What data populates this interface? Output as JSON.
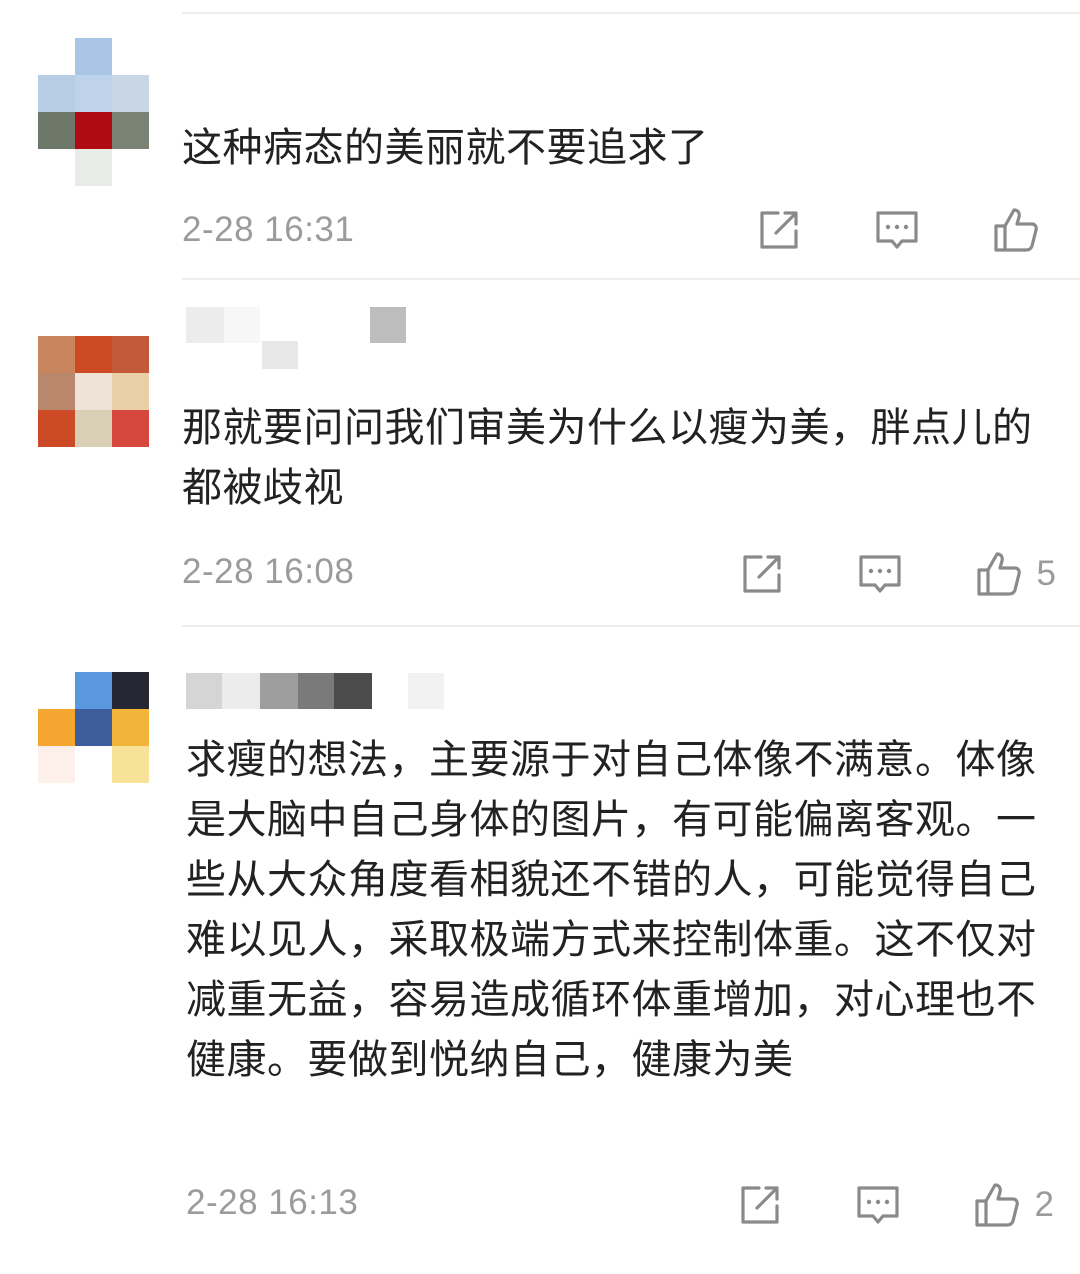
{
  "comments": [
    {
      "text": "这种病态的美丽就不要追求了",
      "time": "2-28 16:31",
      "likes": ""
    },
    {
      "text": "那就要问问我们审美为什么以瘦为美，胖点儿的都被歧视",
      "time": "2-28 16:08",
      "likes": "5"
    },
    {
      "text": "求瘦的想法，主要源于对自己体像不满意。体像是大脑中自己身体的图片，有可能偏离客观。一些从大众角度看相貌还不错的人，可能觉得自己难以见人，采取极端方式来控制体重。这不仅对减重无益，容易造成循环体重增加，对心理也不健康。要做到悦纳自己，健康为美",
      "time": "2-28 16:13",
      "likes": "2"
    }
  ],
  "icons": {
    "share": "share-icon",
    "reply": "comment-icon",
    "like": "thumbs-up-icon"
  },
  "colors": {
    "text": "#222222",
    "meta": "#9b9b9b",
    "icon": "#8a8a8a",
    "separator": "#ededed"
  }
}
